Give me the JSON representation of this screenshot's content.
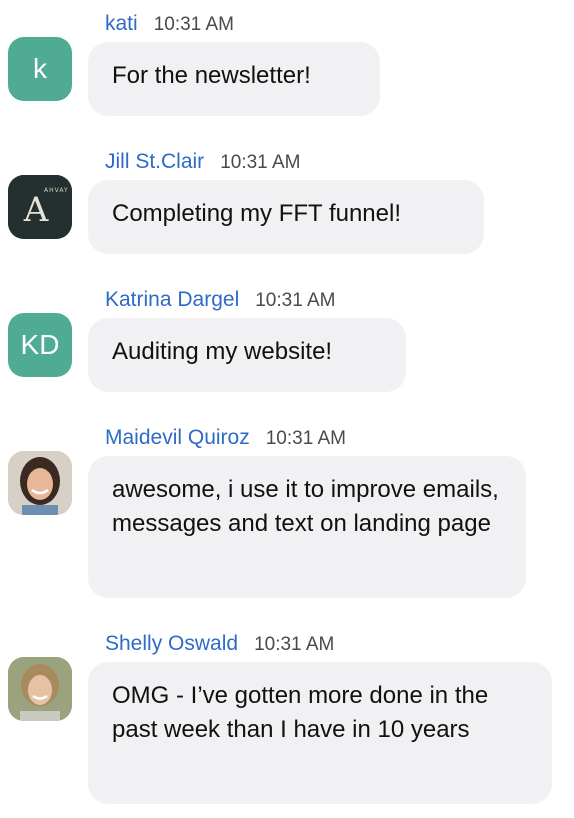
{
  "messages": [
    {
      "sender": "kati",
      "time": "10:31 AM",
      "text": "For the newsletter!",
      "avatar": {
        "type": "initials",
        "initials": "k"
      }
    },
    {
      "sender": "Jill St.Clair",
      "time": "10:31 AM",
      "text": "Completing my FFT funnel!",
      "avatar": {
        "type": "logo",
        "letter": "A",
        "ring_text": "AHVAY"
      }
    },
    {
      "sender": "Katrina Dargel",
      "time": "10:31 AM",
      "text": "Auditing my website!",
      "avatar": {
        "type": "initials",
        "initials": "KD"
      }
    },
    {
      "sender": "Maidevil Quiroz",
      "time": "10:31 AM",
      "text": "awesome, i use it to improve emails, messages and text on landing page",
      "avatar": {
        "type": "photo",
        "icon": "person-photo-icon"
      }
    },
    {
      "sender": "Shelly Oswald",
      "time": "10:31 AM",
      "text": "OMG - I’ve gotten more done in the past week than I have in 10 years",
      "avatar": {
        "type": "photo",
        "icon": "person-photo-icon"
      }
    }
  ],
  "colors": {
    "sender_name": "#2e6bc6",
    "bubble": "#f1f1f4",
    "initials_avatar": "#4fab94",
    "logo_avatar": "#24302f"
  }
}
